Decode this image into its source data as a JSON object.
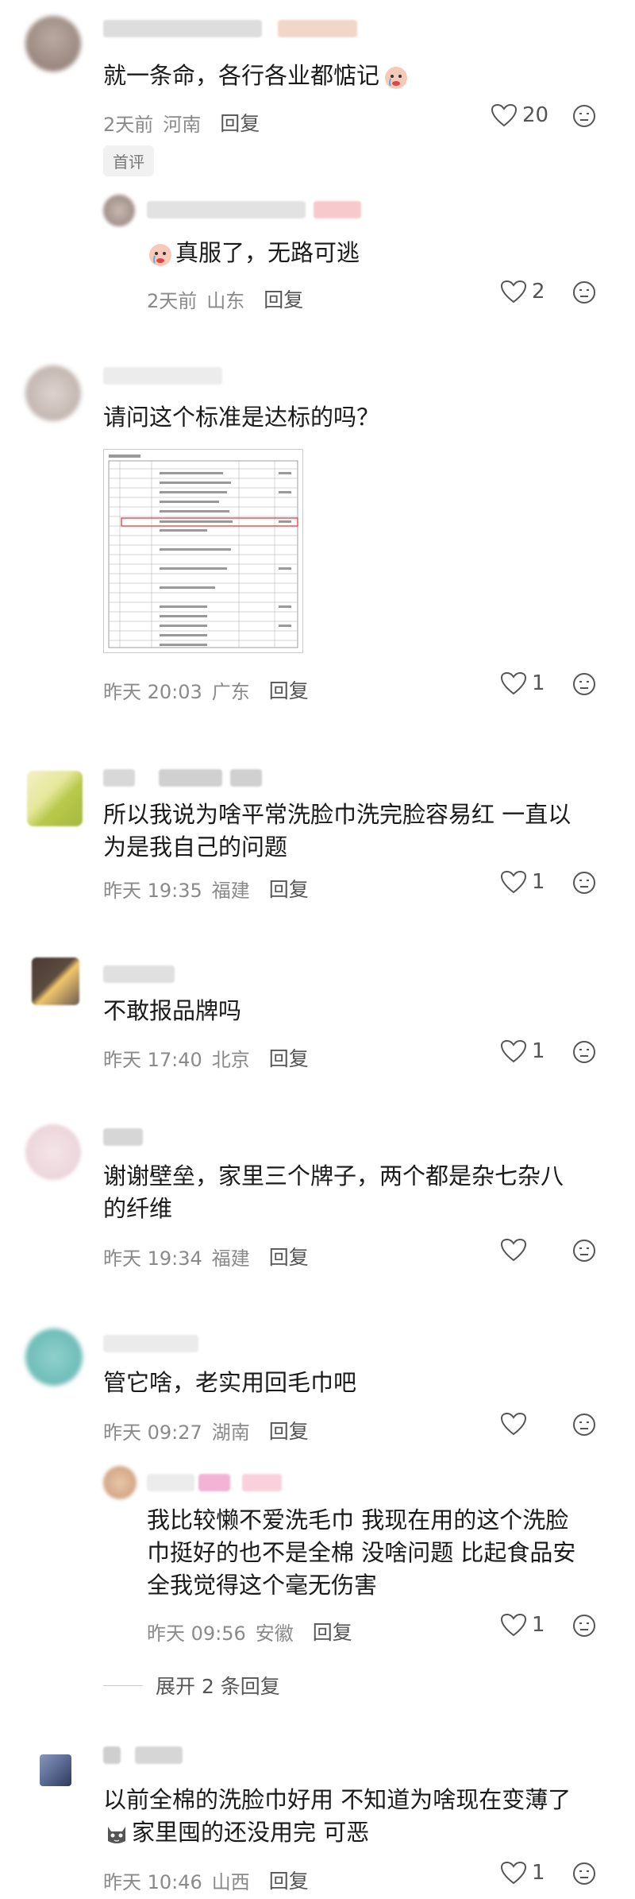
{
  "comments": [
    {
      "text": "就一条命，各行各业都惦记",
      "time": "2天前",
      "region": "河南",
      "reply": "回复",
      "likes": "20",
      "tag": "首评"
    },
    {
      "text": "真服了，无路可逃",
      "time": "2天前",
      "region": "山东",
      "reply": "回复",
      "likes": "2"
    },
    {
      "text": "请问这个标准是达标的吗？",
      "time": "昨天 20:03",
      "region": "广东",
      "reply": "回复",
      "likes": "1"
    },
    {
      "text_line1": "所以我说为啥平常洗脸巾洗完脸容易红 一直以",
      "text_line2": "为是我自己的问题",
      "time": "昨天 19:35",
      "region": "福建",
      "reply": "回复",
      "likes": "1"
    },
    {
      "text": "不敢报品牌吗",
      "time": "昨天 17:40",
      "region": "北京",
      "reply": "回复",
      "likes": "1"
    },
    {
      "text_line1": "谢谢壁垒，家里三个牌子，两个都是杂七杂八",
      "text_line2": "的纤维",
      "time": "昨天 19:34",
      "region": "福建",
      "reply": "回复"
    },
    {
      "text": "管它啥，老实用回毛巾吧",
      "time": "昨天 09:27",
      "region": "湖南",
      "reply": "回复"
    },
    {
      "text_line1": "我比较懒不爱洗毛巾 我现在用的这个洗脸",
      "text_line2": "巾挺好的也不是全棉 没啥问题 比起食品安",
      "text_line3": "全我觉得这个毫无伤害",
      "time": "昨天 09:56",
      "region": "安徽",
      "reply": "回复",
      "likes": "1",
      "expand": "展开 2 条回复"
    },
    {
      "text_line1": "以前全棉的洗脸巾好用 不知道为啥现在变薄了",
      "text_line2": "家里囤的还没用完 可恶",
      "time": "昨天 10:46",
      "region": "山西",
      "reply": "回复",
      "likes": "1"
    }
  ]
}
